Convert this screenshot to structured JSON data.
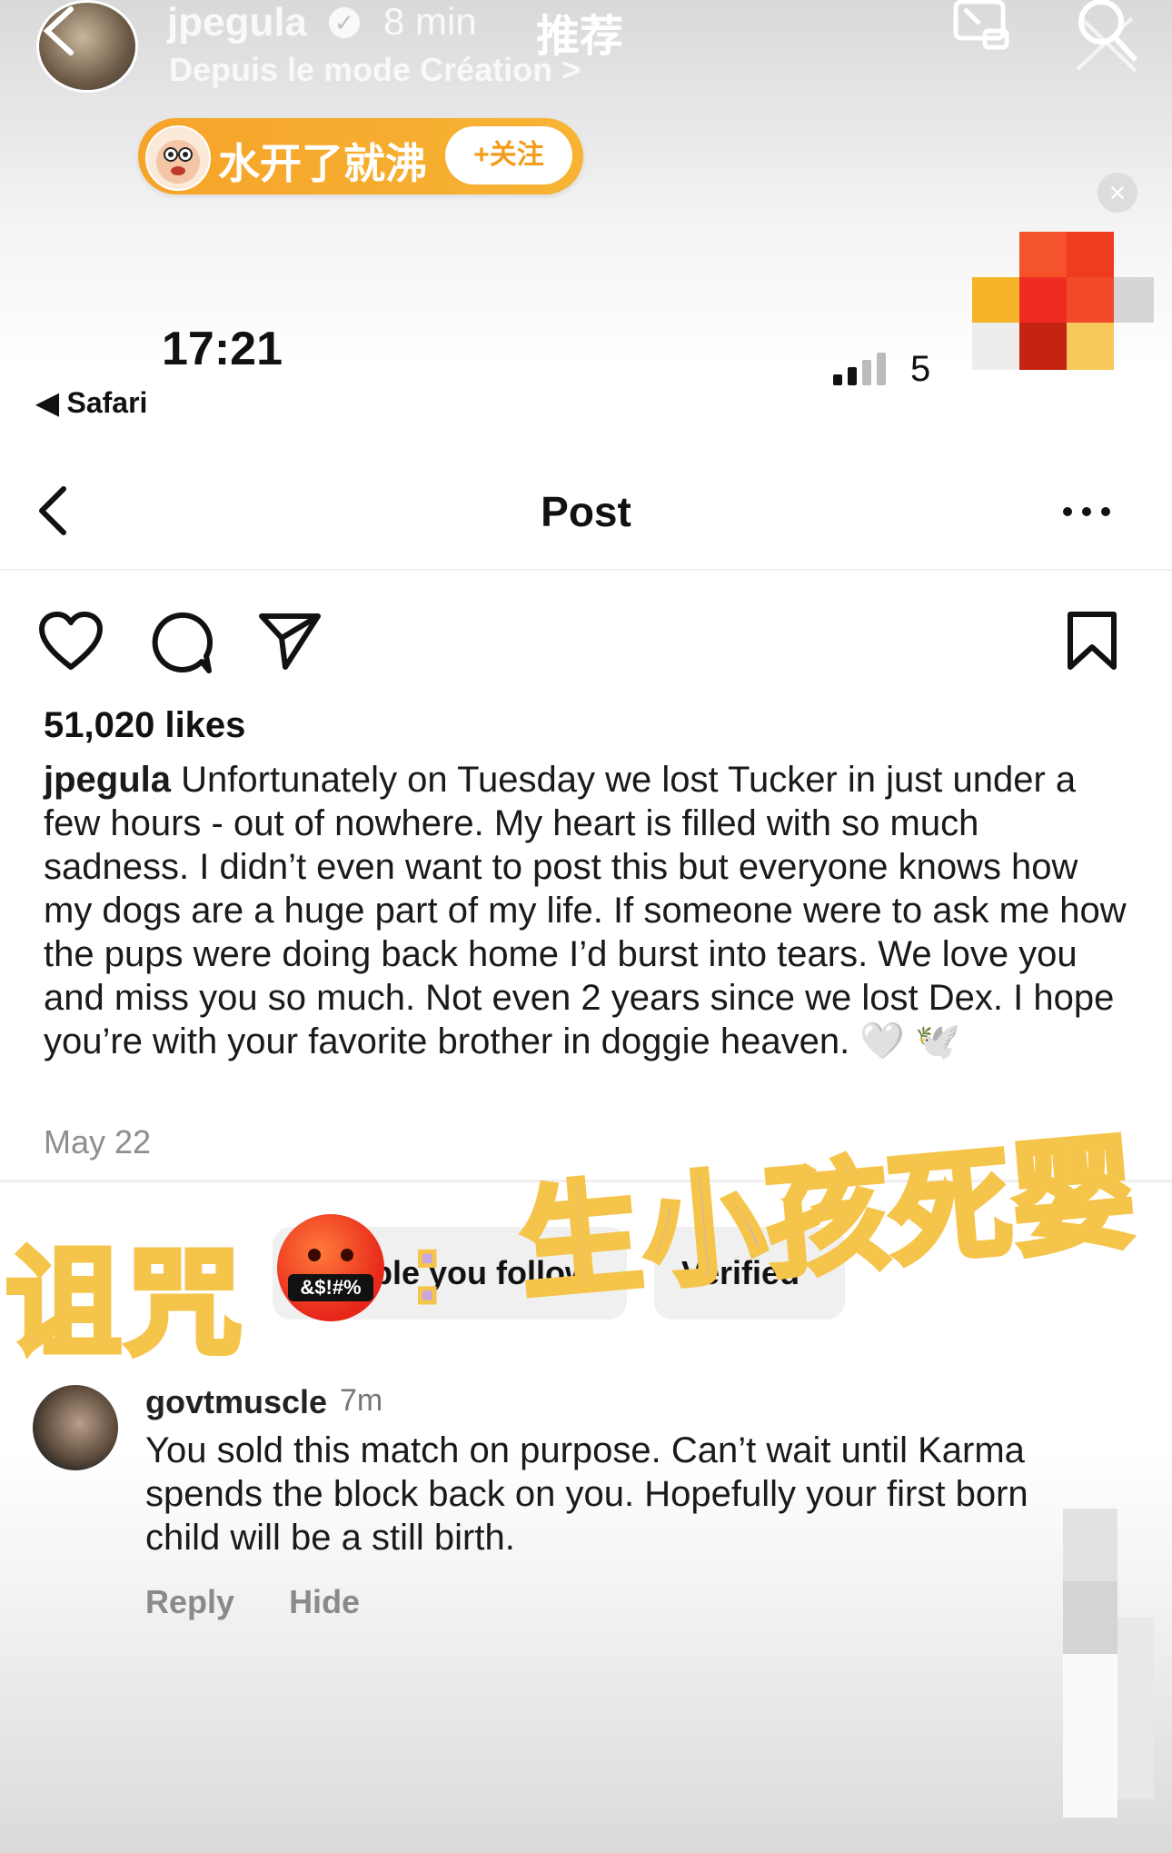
{
  "top_bar": {
    "username": "jpegula",
    "time_ago": "8 min",
    "tab": "推荐",
    "subtitle": "Depuis le mode Création >"
  },
  "follow_pill": {
    "name": "水开了就沸",
    "follow_label": "+关注"
  },
  "status_bar": {
    "time": "17:21",
    "back_app": "◀ Safari",
    "battery": "5"
  },
  "header": {
    "title": "Post"
  },
  "post": {
    "likes": "51,020 likes",
    "caption_user": "jpegula",
    "caption_text": "Unfortunately on Tuesday we lost Tucker in just under a few hours - out of nowhere. My heart is filled with so much sadness. I didn’t even want to post this but everyone knows how my dogs are a huge part of my life. If someone were to ask me how the pups were doing back home I’d burst into tears. We love you and miss you so much. Not even 2 years since we lost Dex. I hope you’re with your favorite brother in doggie heaven. 🤍 🕊️",
    "date": "May 22"
  },
  "tabs_behind": {
    "people_you_follow": "ple you follow",
    "verified": "Verified"
  },
  "overlay_caption": {
    "left": "诅咒",
    "emoji_text": "&$!#%",
    "colon": ":",
    "right": "生小孩死婴"
  },
  "comment": {
    "user": "govtmuscle",
    "time": "7m",
    "text": "You sold this match on purpose. Can’t wait until Karma spends the block back on you. Hopefully your first born child will be a still birth.",
    "reply_label": "Reply",
    "hide_label": "Hide"
  },
  "colors": {
    "pill_orange": "#f6a429",
    "caption_purple": "#c7a6e3",
    "caption_outline": "#f5c44b",
    "muted_text": "#8e8e8e"
  }
}
